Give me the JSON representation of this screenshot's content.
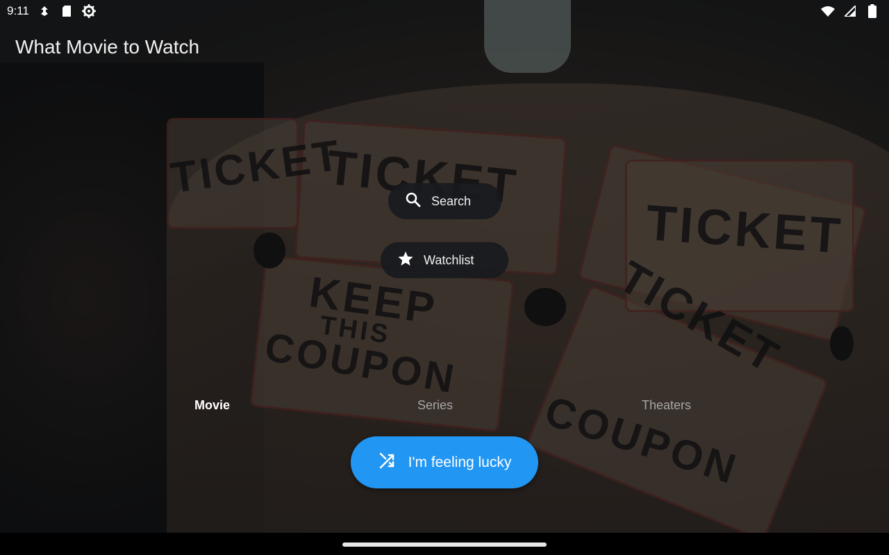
{
  "status_bar": {
    "time": "9:11",
    "left_icons": [
      "signal-arrow-icon",
      "sd-card-icon",
      "settings-gear-icon"
    ],
    "right_icons": [
      "wifi-icon",
      "cell-signal-icon",
      "battery-icon"
    ]
  },
  "app": {
    "title": "What Movie to Watch"
  },
  "actions": {
    "search_label": "Search",
    "watchlist_label": "Watchlist"
  },
  "tabs": [
    {
      "label": "Movie",
      "selected": true
    },
    {
      "label": "Series",
      "selected": false
    },
    {
      "label": "Theaters",
      "selected": false
    }
  ],
  "lucky_button": {
    "label": "I'm feeling lucky",
    "color": "#2196f3"
  },
  "background_text": {
    "ticket": "TICKET",
    "keep": "KEEP",
    "this": "THIS",
    "coupon": "COUPON"
  }
}
